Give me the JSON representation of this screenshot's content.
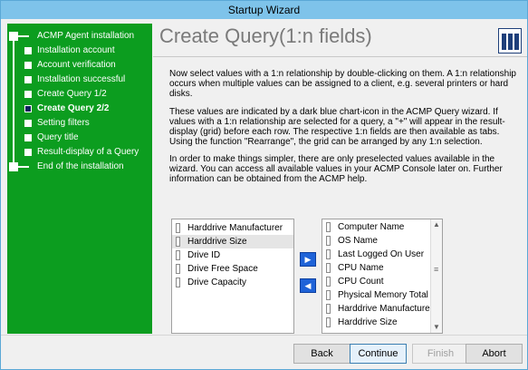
{
  "window": {
    "title": "Startup Wizard"
  },
  "sidebar": {
    "steps": [
      {
        "label": "ACMP Agent installation"
      },
      {
        "label": "Installation account"
      },
      {
        "label": "Account verification"
      },
      {
        "label": "Installation successful"
      },
      {
        "label": "Create Query 1/2"
      },
      {
        "label": "Create Query 2/2"
      },
      {
        "label": "Setting filters"
      },
      {
        "label": "Query title"
      },
      {
        "label": "Result-display of a Query"
      },
      {
        "label": "End of the installation"
      }
    ],
    "current_step": "Create Query 2/2"
  },
  "header": {
    "title": "Create Query(1:n fields)",
    "icon": "chart-icon"
  },
  "body": {
    "paragraphs": [
      "Now select values with a 1:n relationship by double-clicking on them. A 1:n relationship occurs when multiple values can be assigned to a client, e.g. several printers or hard disks.",
      "These values are indicated by a dark blue chart-icon in the ACMP Query wizard. If values with a 1:n relationship are selected for a query, a \"+\" will appear in the result-display (grid) before each row. The respective 1:n fields are then available as tabs. Using the function \"Rearrange\", the grid can be arranged by any 1:n selection.",
      "In order to make things simpler, there are only preselected values available in the wizard. You can access all available values in your ACMP Console later on. Further information can be obtained from the ACMP help."
    ]
  },
  "selected_fields": {
    "items": [
      "Harddrive Manufacturer",
      "Harddrive Size",
      "Drive ID",
      "Drive Free Space",
      "Drive Capacity"
    ],
    "highlighted": "Harddrive Size"
  },
  "available_fields": {
    "items": [
      "Computer Name",
      "OS Name",
      "Last Logged On User",
      "CPU Name",
      "CPU Count",
      "Physical Memory Total",
      "Harddrive Manufacturer",
      "Harddrive Size"
    ]
  },
  "transfer": {
    "add_icon": "arrow-right-icon",
    "remove_icon": "arrow-left-icon",
    "add_glyph": "▶",
    "remove_glyph": "◀"
  },
  "buttons": {
    "back": "Back",
    "continue": "Continue",
    "finish": "Finish",
    "abort": "Abort"
  },
  "colors": {
    "sidebar": "#0c9d1f",
    "titlebar": "#7ec3ea",
    "current_node": "#0a1f5c",
    "transfer_button": "#1f63d8"
  }
}
